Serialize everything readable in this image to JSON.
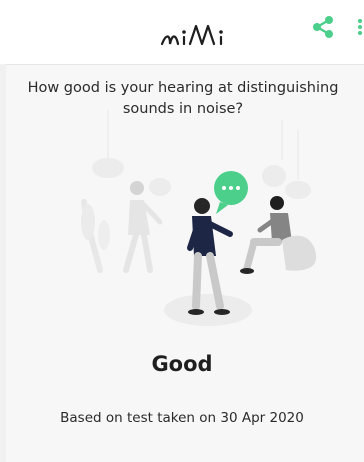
{
  "header": {
    "logo_text": "mimi",
    "share_icon": "share-icon",
    "more_icon": "more-vertical-icon",
    "accent_color": "#4ccf8b"
  },
  "main": {
    "question": "How good is your hearing at distinguishing sounds in noise?",
    "result": "Good",
    "test_info": "Based on test taken on 30 Apr 2020"
  }
}
